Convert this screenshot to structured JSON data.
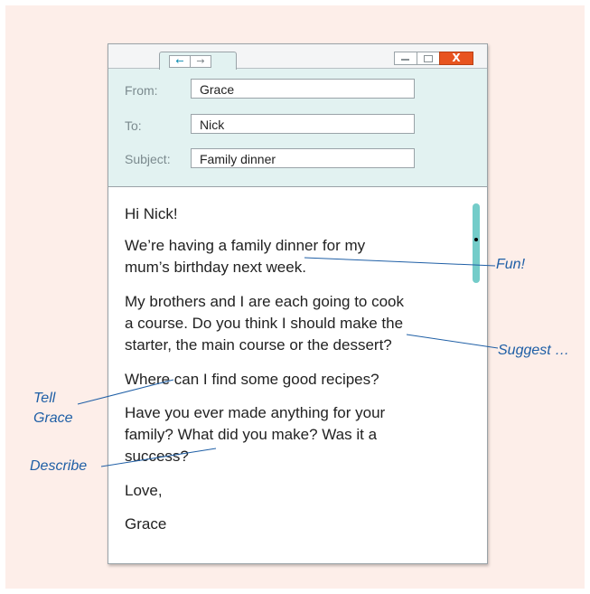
{
  "window": {
    "controls": {
      "minimize": "minimize",
      "maximize": "maximize",
      "close": "X"
    },
    "nav": {
      "back": "←",
      "forward": "→"
    }
  },
  "fields": {
    "from": {
      "label": "From:",
      "value": "Grace"
    },
    "to": {
      "label": "To:",
      "value": "Nick"
    },
    "subject": {
      "label": "Subject:",
      "value": "Family dinner"
    }
  },
  "message": {
    "greeting": "Hi Nick!",
    "p1_l1": "We’re having a family dinner for my",
    "p1_l2": "mum’s birthday next week.",
    "p2_l1": "My brothers and I are each going to cook",
    "p2_l2": "a course. Do you think I should make the",
    "p2_l3": "starter, the main course or the dessert?",
    "p3": "Where can I find some good recipes?",
    "p4_l1": "Have you ever made anything for your",
    "p4_l2": "family? What did you make? Was it a",
    "p4_l3": "success?",
    "closing": "Love,",
    "signature": "Grace"
  },
  "notes": {
    "fun": "Fun!",
    "suggest": "Suggest …",
    "tell_l1": "Tell",
    "tell_l2": "Grace",
    "describe": "Describe"
  },
  "colors": {
    "header": "#e2f2f1",
    "background": "#fdeee9",
    "accent": "#1f5fa6",
    "scrollbar": "#74ccc9",
    "close": "#e8541f"
  }
}
